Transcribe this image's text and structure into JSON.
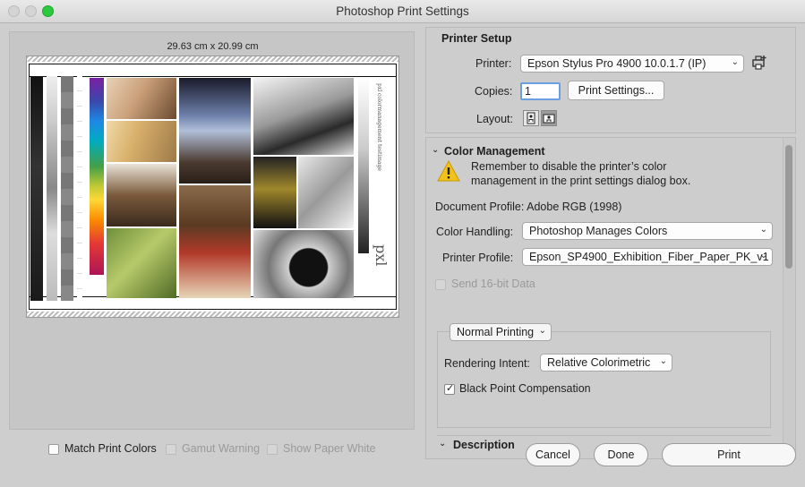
{
  "window": {
    "title": "Photoshop Print Settings"
  },
  "preview": {
    "paper_size": "29.63 cm x 20.99 cm"
  },
  "printer_setup": {
    "title": "Printer Setup",
    "printer_label": "Printer:",
    "printer_value": "Epson Stylus Pro 4900 10.0.1.7 (IP)",
    "copies_label": "Copies:",
    "copies_value": "1",
    "print_settings_button": "Print Settings...",
    "layout_label": "Layout:"
  },
  "color_management": {
    "title": "Color Management",
    "warning": "Remember to disable the printer’s color management in the print settings dialog box.",
    "warning_line1": "Remember to disable the printer’s color",
    "warning_line2": "management in the print settings dialog box.",
    "document_profile": "Document Profile: Adobe RGB (1998)",
    "color_handling_label": "Color Handling:",
    "color_handling_value": "Photoshop Manages Colors",
    "printer_profile_label": "Printer Profile:",
    "printer_profile_value": "Epson_SP4900_Exhibition_Fiber_Paper_PK_v1",
    "send_16bit_label": "Send 16-bit Data",
    "normal_printing_value": "Normal Printing",
    "rendering_intent_label": "Rendering Intent:",
    "rendering_intent_value": "Relative Colorimetric",
    "black_point_label": "Black Point Compensation",
    "black_point_checked": true
  },
  "description": {
    "title": "Description"
  },
  "bottom": {
    "match_print_colors": "Match Print Colors",
    "gamut_warning": "Gamut Warning",
    "show_paper_white": "Show Paper White",
    "cancel": "Cancel",
    "done": "Done",
    "print": "Print"
  },
  "colors": {
    "accent_blue": "#6c9fe0",
    "warning_yellow": "#f2c21b"
  }
}
